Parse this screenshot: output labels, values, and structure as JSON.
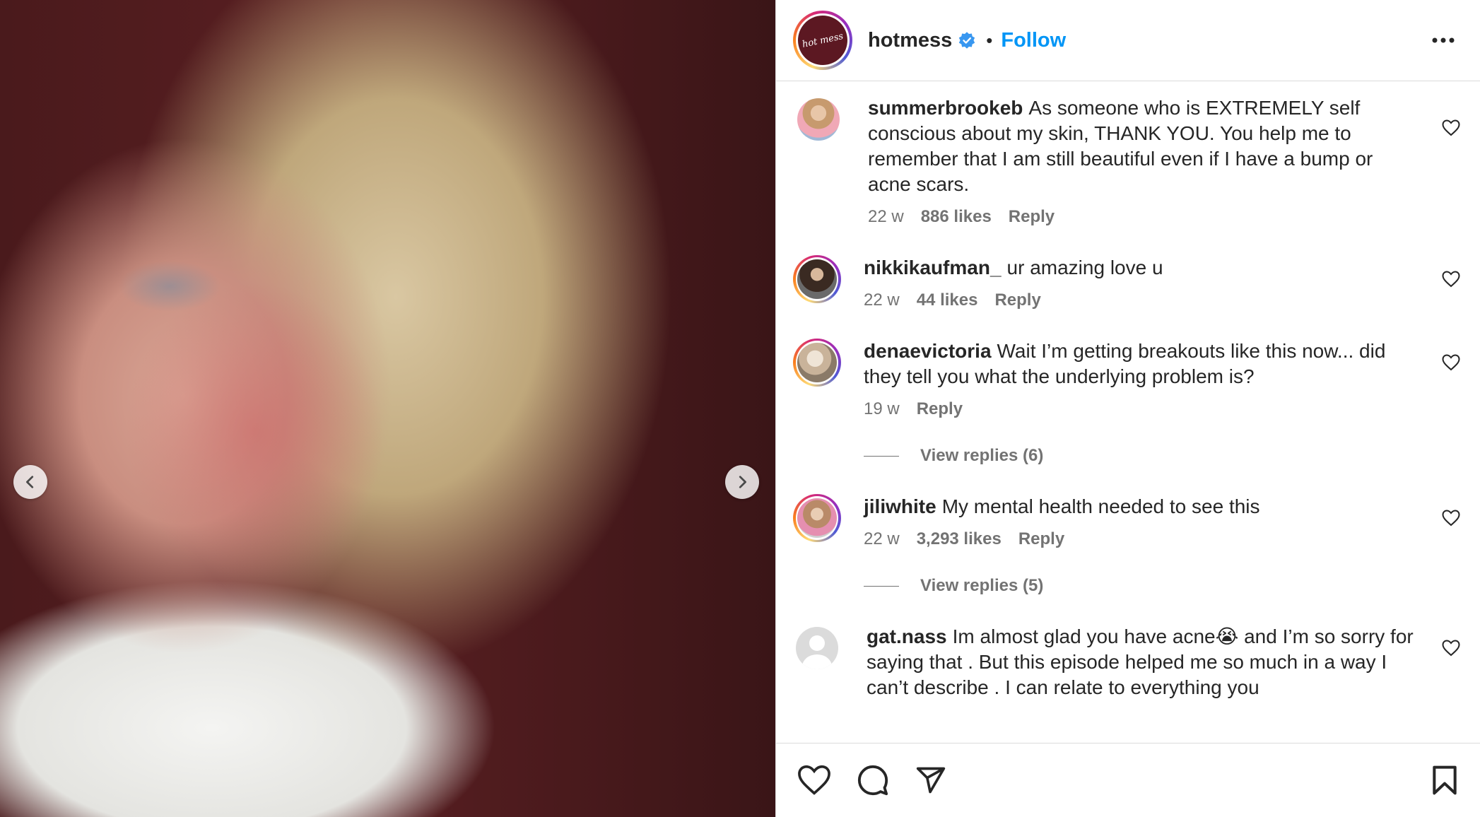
{
  "post": {
    "username": "hotmess",
    "avatar_text": "hot mess",
    "dot": "•",
    "follow_label": "Follow",
    "colors": {
      "follow": "#0095f6",
      "verified": "#3897f0",
      "text": "#262626",
      "muted": "#737373"
    }
  },
  "media": {
    "description_icon_prev": "chevron-left-icon",
    "description_icon_next": "chevron-right-icon"
  },
  "comments": [
    {
      "username": "summerbrookeb",
      "text": "As someone who is EXTREMELY self conscious about my skin, THANK YOU. You help me to remember that I am still beautiful even if I have a bump or acne scars.",
      "time": "22 w",
      "likes": "886 likes",
      "reply": "Reply",
      "story_ring": false
    },
    {
      "username": "nikkikaufman_",
      "text": "ur amazing love u",
      "time": "22 w",
      "likes": "44 likes",
      "reply": "Reply",
      "story_ring": true
    },
    {
      "username": "denaevictoria",
      "text": "Wait I’m getting breakouts like this now... did they tell you what the underlying problem is?",
      "time": "19 w",
      "reply": "Reply",
      "view_replies": "View replies (6)",
      "story_ring": true
    },
    {
      "username": "jiliwhite",
      "text": "My mental health needed to see this",
      "time": "22 w",
      "likes": "3,293 likes",
      "reply": "Reply",
      "view_replies": "View replies (5)",
      "story_ring": true
    },
    {
      "username": "gat.nass",
      "text": "Im almost glad you have acne😭 and I’m so sorry for saying that . But this episode helped me so much in a way I can’t describe . I can relate to everything you",
      "story_ring": false
    }
  ],
  "actions": {
    "icons": [
      "heart-icon",
      "comment-icon",
      "share-icon",
      "bookmark-icon"
    ]
  }
}
